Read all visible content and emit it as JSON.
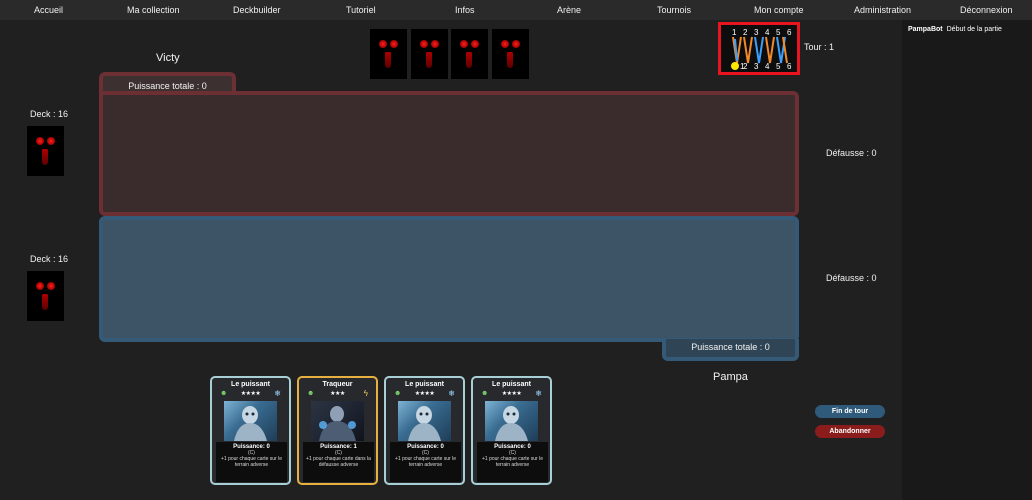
{
  "nav": [
    "Accueil",
    "Ma collection",
    "Deckbuilder",
    "Tutoriel",
    "Infos",
    "Arène",
    "Tournois",
    "Mon compte",
    "Administration",
    "Déconnexion"
  ],
  "log": {
    "author": "PampaBot",
    "message": "Début de la partie"
  },
  "opponent": {
    "name": "Victy",
    "deck": "Deck : 16",
    "discard": "Défausse : 0",
    "total_power": "Puissance totale : 0",
    "hand_count": 4
  },
  "player": {
    "name": "Pampa",
    "deck": "Deck : 16",
    "discard": "Défausse : 0",
    "total_power": "Puissance totale : 0"
  },
  "turn": {
    "label": "Tour : 1",
    "top_numbers": [
      "1",
      "2",
      "3",
      "4",
      "5",
      "6"
    ],
    "bottom_numbers": [
      "1",
      "2",
      "3",
      "4",
      "5",
      "6"
    ],
    "marker_color": "#ffe600",
    "highlight_color": "#e8141f"
  },
  "buttons": {
    "end_turn": "Fin de tour",
    "forfeit": "Abandonner"
  },
  "hand": [
    {
      "name": "Le puissant",
      "stars": "★★★★",
      "power": "Puissance: 0",
      "tag": "(C)",
      "desc": "+1 pour chaque carte sur le terrain adverse",
      "type_icon": "alien-icon",
      "element_icon": "snowflake-icon",
      "rarity": "blue"
    },
    {
      "name": "Traqueur",
      "stars": "★★★",
      "power": "Puissance: 1",
      "tag": "(C)",
      "desc": "+1 pour chaque carte dans la défausse adverse",
      "type_icon": "alien-icon",
      "element_icon": "lightning-icon",
      "rarity": "gold"
    },
    {
      "name": "Le puissant",
      "stars": "★★★★",
      "power": "Puissance: 0",
      "tag": "(C)",
      "desc": "+1 pour chaque carte sur le terrain adverse",
      "type_icon": "alien-icon",
      "element_icon": "snowflake-icon",
      "rarity": "blue"
    },
    {
      "name": "Le puissant",
      "stars": "★★★★",
      "power": "Puissance: 0",
      "tag": "(C)",
      "desc": "+1 pour chaque carte sur le terrain adverse",
      "type_icon": "alien-icon",
      "element_icon": "snowflake-icon",
      "rarity": "blue"
    }
  ]
}
